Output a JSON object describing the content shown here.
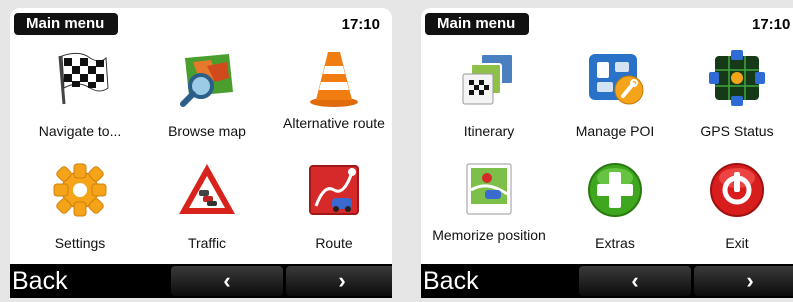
{
  "left_screen": {
    "title": "Main menu",
    "time": "17:10",
    "items": [
      {
        "label": "Navigate to...",
        "icon": "checkered-flag-icon"
      },
      {
        "label": "Browse map",
        "icon": "map-magnifier-icon"
      },
      {
        "label": "Alternative route",
        "icon": "traffic-cone-icon"
      },
      {
        "label": "Settings",
        "icon": "gear-icon"
      },
      {
        "label": "Traffic",
        "icon": "traffic-warning-icon"
      },
      {
        "label": "Route",
        "icon": "route-icon"
      }
    ],
    "back_label": "Back",
    "prev_label": "‹",
    "next_label": "›"
  },
  "right_screen": {
    "title": "Main menu",
    "time": "17:10",
    "items": [
      {
        "label": "Itinerary",
        "icon": "itinerary-icon"
      },
      {
        "label": "Manage POI",
        "icon": "poi-icon"
      },
      {
        "label": "GPS Status",
        "icon": "gps-satellite-icon"
      },
      {
        "label": "Memorize position",
        "icon": "memorize-position-icon"
      },
      {
        "label": "Extras",
        "icon": "plus-icon"
      },
      {
        "label": "Exit",
        "icon": "power-icon"
      }
    ],
    "back_label": "Back",
    "prev_label": "‹",
    "next_label": "›"
  }
}
